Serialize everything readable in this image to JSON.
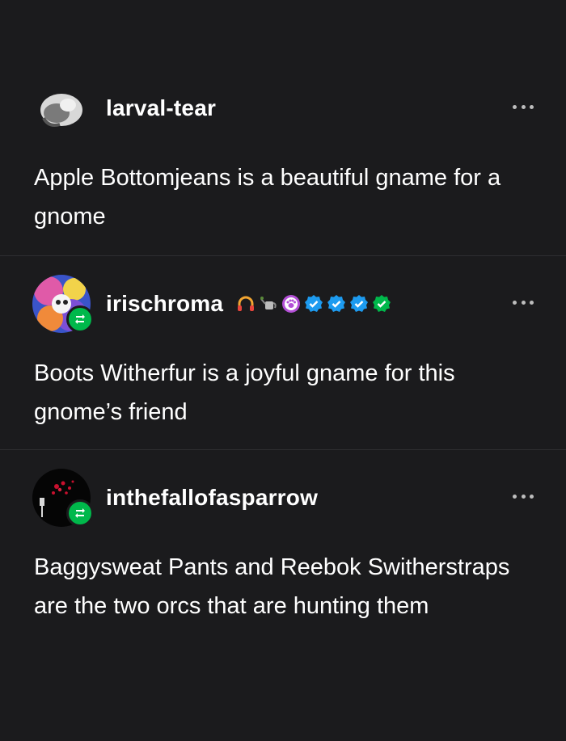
{
  "posts": [
    {
      "username": "larval-tear",
      "text": "Apple Bottomjeans is a beautiful gname for a gnome",
      "reblog": false
    },
    {
      "username": "irischroma",
      "text": "Boots Witherfur is a joyful gname for this gnome’s friend",
      "reblog": true,
      "badges": [
        "headphones-icon",
        "watering-can-icon",
        "paw-badge-icon",
        "blue-check-icon",
        "blue-check-icon",
        "blue-check-icon",
        "green-check-icon"
      ]
    },
    {
      "username": "inthefallofasparrow",
      "text": "Baggysweat Pants and Reebok Switherstraps are the two orcs that are hunting them",
      "reblog": true
    }
  ],
  "colors": {
    "background": "#1b1b1d",
    "reblog_green": "#00b84b",
    "check_blue": "#1d9bf0",
    "check_green": "#00b84b",
    "paw_purple": "#b34fd6"
  }
}
